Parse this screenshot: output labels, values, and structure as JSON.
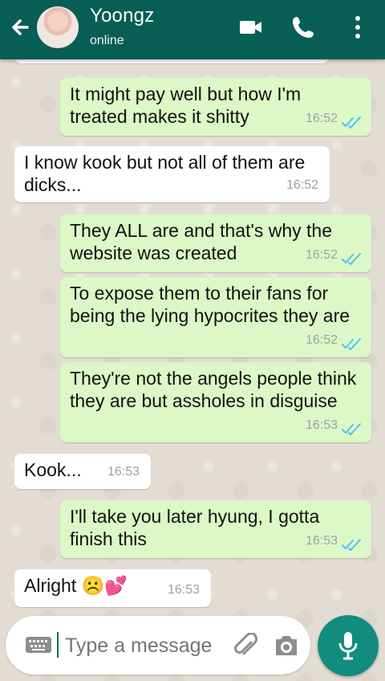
{
  "header": {
    "title": "Yoongz",
    "status": "online"
  },
  "messages": [
    {
      "text": "It might pay well but how I'm treated makes it shitty",
      "time": "16:52"
    },
    {
      "text": "I know kook but not all of them are dicks...",
      "time": "16:52"
    },
    {
      "text": "They ALL are and that's why the website was created",
      "time": "16:52"
    },
    {
      "text": "To expose them to their fans for being the lying hypocrites they are",
      "time": "16:52"
    },
    {
      "text": "They're not the angels people think they are but assholes in disguise",
      "time": "16:53"
    },
    {
      "text": "Kook...",
      "time": "16:53"
    },
    {
      "text": "I'll take you later hyung, I gotta finish this",
      "time": "16:53"
    },
    {
      "text": "Alright",
      "emoji": "☹️💕",
      "time": "16:53"
    }
  ],
  "composer": {
    "placeholder": "Type a message"
  },
  "colors": {
    "header": "#075e54",
    "outgoing": "#dcf8c6",
    "incoming": "#ffffff",
    "mic": "#128c7e",
    "ticks": "#4fc3f7"
  }
}
